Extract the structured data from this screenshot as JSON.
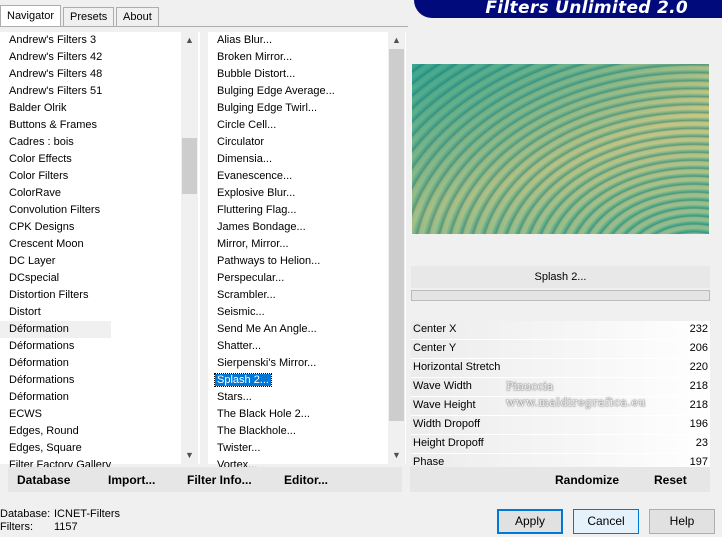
{
  "tabs": [
    "Navigator",
    "Presets",
    "About"
  ],
  "title": "Filters Unlimited 2.0",
  "categories": [
    "Andrew's Filters 3",
    "Andrew's Filters 42",
    "Andrew's Filters 48",
    "Andrew's Filters 51",
    "Balder Olrik",
    "Buttons & Frames",
    "Cadres : bois",
    "Color Effects",
    "Color Filters",
    "ColorRave",
    "Convolution Filters",
    "CPK Designs",
    "Crescent Moon",
    "DC Layer",
    "DCspecial",
    "Distortion Filters",
    "Distort",
    "Déformation",
    "Déformations",
    "Déformation",
    "Déformations",
    "Déformation",
    "ECWS",
    "Edges, Round",
    "Edges, Square",
    "Filter Factory Gallery"
  ],
  "filters": [
    "Alias Blur...",
    "Broken Mirror...",
    "Bubble Distort...",
    "Bulging Edge Average...",
    "Bulging Edge Twirl...",
    "Circle Cell...",
    "Circulator",
    "Dimensia...",
    "Evanescence...",
    "Explosive Blur...",
    "Fluttering Flag...",
    "James Bondage...",
    "Mirror, Mirror...",
    "Pathways to Helion...",
    "Perspecular...",
    "Scrambler...",
    "Seismic...",
    "Send Me An Angle...",
    "Shatter...",
    "Sierpenski's Mirror...",
    "Splash 2...",
    "Stars...",
    "The Black Hole 2...",
    "The Blackhole...",
    "Twister...",
    "Vortex..."
  ],
  "selected_category_index": 17,
  "selected_filter_index": 20,
  "filter_name": "Splash 2...",
  "parameters": [
    {
      "label": "Center X",
      "value": "232"
    },
    {
      "label": "Center Y",
      "value": "206"
    },
    {
      "label": "Horizontal Stretch",
      "value": "220"
    },
    {
      "label": "Wave Width",
      "value": "218"
    },
    {
      "label": "Wave Height",
      "value": "218"
    },
    {
      "label": "Width Dropoff",
      "value": "196"
    },
    {
      "label": "Height Dropoff",
      "value": "23"
    },
    {
      "label": "Phase",
      "value": "197"
    }
  ],
  "bottom_buttons": {
    "database": "Database",
    "import": "Import...",
    "filter_info": "Filter Info...",
    "editor": "Editor..."
  },
  "right_buttons": {
    "randomize": "Randomize",
    "reset": "Reset"
  },
  "status": {
    "database_label": "Database:",
    "database_value": "ICNET-Filters",
    "filters_label": "Filters:",
    "filters_value": "1157"
  },
  "dialog_buttons": {
    "apply": "Apply",
    "cancel": "Cancel",
    "help": "Help"
  },
  "watermark": {
    "line1": "Pinuccia",
    "line2": "www.maldiregrafica.eu"
  },
  "colors": {
    "title_banner": "#000a7a",
    "selection": "#0078d7"
  }
}
